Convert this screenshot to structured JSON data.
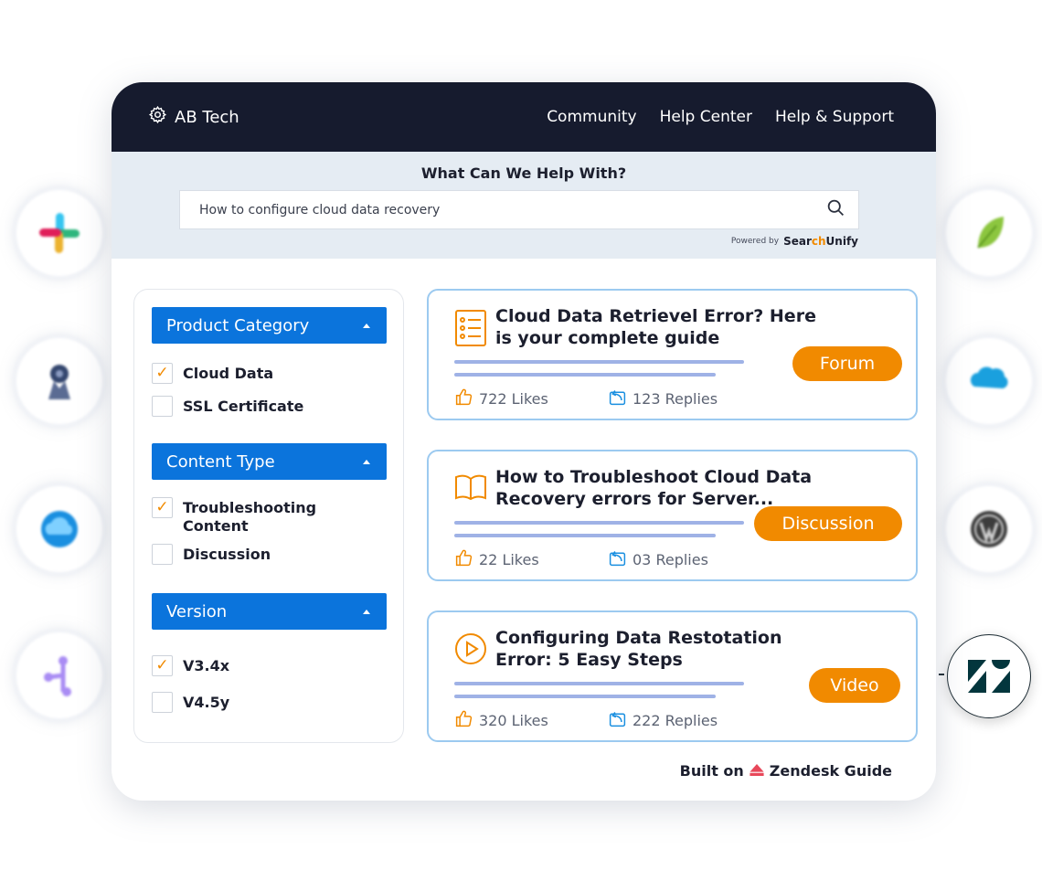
{
  "header": {
    "brand": "AB Tech",
    "nav": [
      "Community",
      "Help Center",
      "Help & Support"
    ]
  },
  "search": {
    "title": "What Can We Help With?",
    "query": "How to configure cloud data recovery",
    "powered_by": "Powered by",
    "provider_a": "Sear",
    "provider_b": "ch",
    "provider_c": "Unify"
  },
  "filters": [
    {
      "label": "Product Category",
      "options": [
        {
          "label": "Cloud Data",
          "checked": true
        },
        {
          "label": "SSL Certificate",
          "checked": false
        }
      ]
    },
    {
      "label": "Content Type",
      "options": [
        {
          "label": "Troubleshooting Content",
          "checked": true
        },
        {
          "label": "Discussion",
          "checked": false
        }
      ]
    },
    {
      "label": "Version",
      "options": [
        {
          "label": "V3.4x",
          "checked": true
        },
        {
          "label": "V4.5y",
          "checked": false
        }
      ]
    }
  ],
  "results": [
    {
      "title": "Cloud Data Retrievel Error? Here is your complete guide",
      "tag": "Forum",
      "likes": "722 Likes",
      "replies": "123 Replies",
      "icon": "document-list-icon"
    },
    {
      "title": "How to Troubleshoot Cloud Data Recovery errors for Server...",
      "tag": "Discussion",
      "likes": "22 Likes",
      "replies": "03 Replies",
      "icon": "open-book-icon"
    },
    {
      "title": "Configuring Data Restotation Error: 5 Easy Steps",
      "tag": "Video",
      "likes": "320 Likes",
      "replies": "222 Replies",
      "icon": "play-circle-icon"
    }
  ],
  "footer": {
    "built_on": "Built on",
    "platform": "Zendesk Guide"
  },
  "colors": {
    "header_bg": "#161b2e",
    "accent_blue": "#0b74dc",
    "accent_orange": "#f18a00",
    "card_border": "#9ccaf0"
  },
  "integrations": [
    "slack-icon",
    "jira-icon",
    "cloud-icon",
    "fork-icon",
    "leaf-icon",
    "salesforce-icon",
    "wordpress-icon",
    "zendesk-icon"
  ]
}
